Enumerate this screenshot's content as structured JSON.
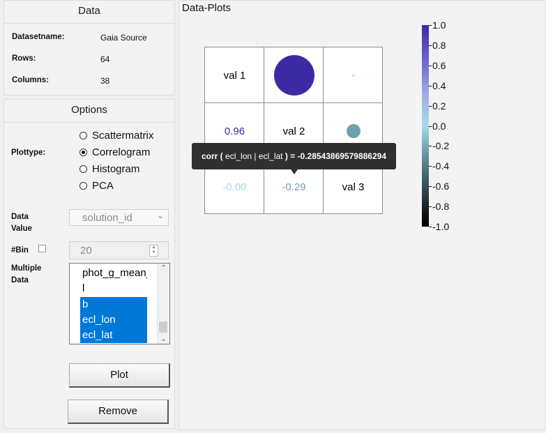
{
  "data_panel": {
    "title": "Data",
    "rows": [
      {
        "label": "Datasetname:",
        "value": "Gaia Source"
      },
      {
        "label": "Rows:",
        "value": "64"
      },
      {
        "label": "Columns:",
        "value": "38"
      }
    ]
  },
  "options_panel": {
    "title": "Options",
    "plottype_label": "Plottype:",
    "plottypes": [
      {
        "label": "Scattermatrix",
        "selected": false
      },
      {
        "label": "Correlogram",
        "selected": true
      },
      {
        "label": "Histogram",
        "selected": false
      },
      {
        "label": "PCA",
        "selected": false
      }
    ],
    "data_value_label": "Data Value",
    "data_value_selected": "solution_id",
    "bin_label": "#Bin",
    "bin_checked": false,
    "bin_value": "20",
    "multiple_data_label": "Multiple Data",
    "multiple_data_items": [
      {
        "label": "phot_g_mean_mag",
        "selected": false
      },
      {
        "label": "l",
        "selected": false
      },
      {
        "label": "b",
        "selected": true
      },
      {
        "label": "ecl_lon",
        "selected": true
      },
      {
        "label": "ecl_lat",
        "selected": true
      }
    ],
    "plot_button": "Plot",
    "remove_button": "Remove"
  },
  "plot_panel": {
    "title": "Data-Plots",
    "diag_labels": [
      "val 1",
      "val 2",
      "val 3"
    ],
    "lower_values": [
      "0.96",
      "-0.00",
      "-0.29"
    ],
    "tooltip": {
      "prefix": "corr ( ",
      "pair": "ecl_lon | ecl_lat",
      "suffix": " ) = ",
      "value": "-0.28543869579886294"
    },
    "colorbar_ticks": [
      "1.0",
      "0.8",
      "0.6",
      "0.4",
      "0.2",
      "0.0",
      "-0.2",
      "-0.4",
      "-0.6",
      "-0.8",
      "-1.0"
    ],
    "colors": {
      "positive_high": "#3b2aa3",
      "near_zero": "#a6dbe8",
      "negative_mid": "#6da1ae"
    }
  },
  "chart_data": {
    "type": "heatmap",
    "variables": [
      "val 1",
      "val 2",
      "val 3"
    ],
    "correlations": [
      {
        "pair": [
          "val 1",
          "val 2"
        ],
        "value": 0.96
      },
      {
        "pair": [
          "val 1",
          "val 3"
        ],
        "value": -0.0
      },
      {
        "pair": [
          "val 2",
          "val 3"
        ],
        "value": -0.28543869579886294
      }
    ],
    "color_range": [
      -1.0,
      1.0
    ]
  }
}
